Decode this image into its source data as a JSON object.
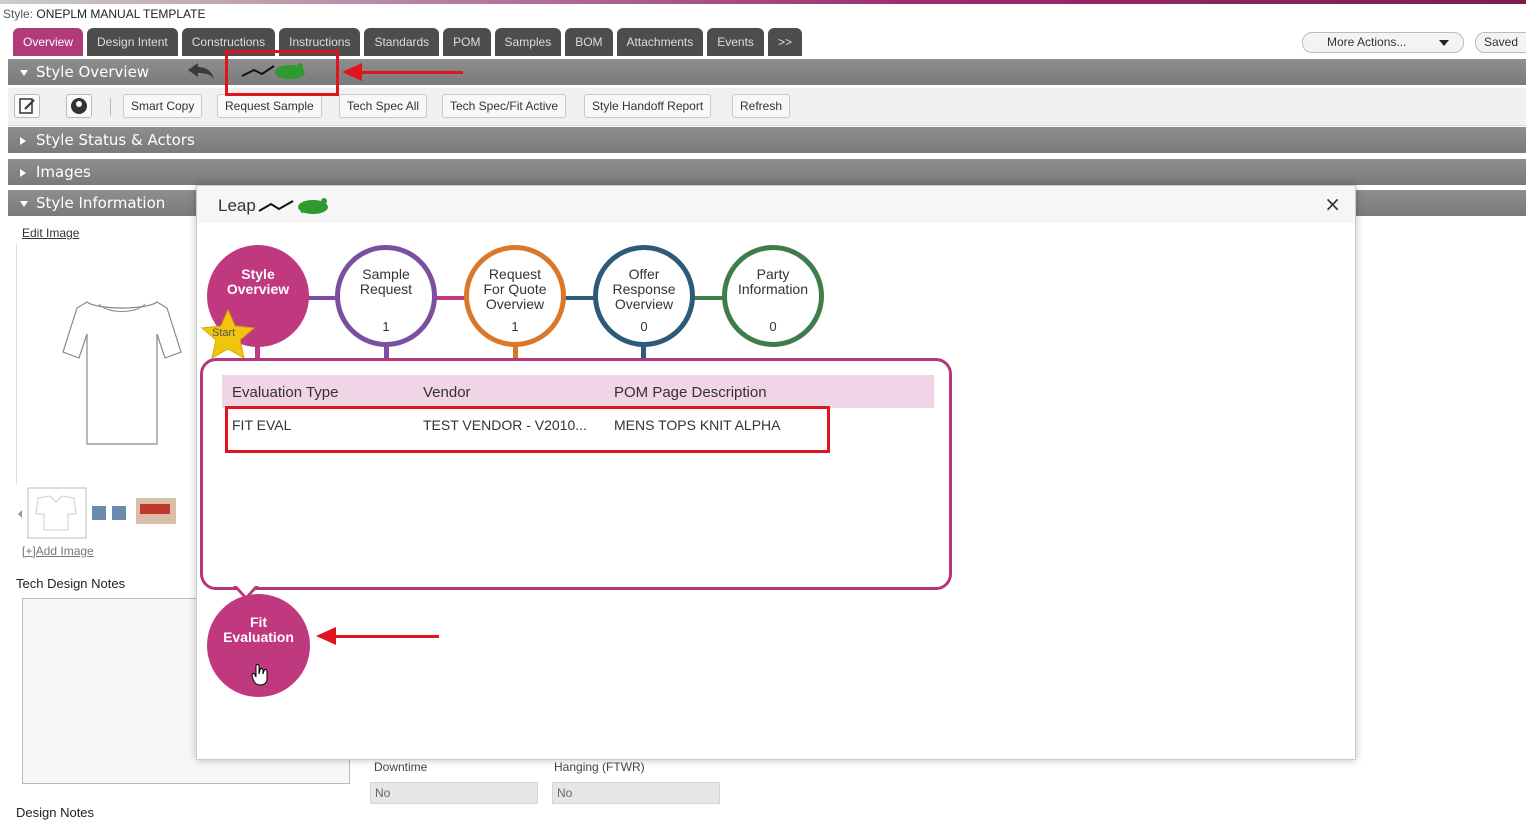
{
  "header": {
    "style_label": "Style:",
    "style_name": "ONEPLM MANUAL TEMPLATE"
  },
  "tabs": [
    {
      "label": "Overview",
      "active": true
    },
    {
      "label": "Design Intent"
    },
    {
      "label": "Constructions"
    },
    {
      "label": "Instructions"
    },
    {
      "label": "Standards"
    },
    {
      "label": "POM"
    },
    {
      "label": "Samples"
    },
    {
      "label": "BOM"
    },
    {
      "label": "Attachments"
    },
    {
      "label": "Events"
    },
    {
      "label": ">>"
    }
  ],
  "actions": {
    "more_actions": "More Actions...",
    "saved": "Saved"
  },
  "sections": {
    "style_overview": "Style Overview",
    "style_status": "Style Status & Actors",
    "images": "Images",
    "style_information": "Style Information"
  },
  "toolbar": {
    "buttons": [
      "Smart Copy",
      "Request Sample",
      "Tech Spec All",
      "Tech Spec/Fit Active",
      "Style Handoff Report",
      "Refresh"
    ]
  },
  "left": {
    "edit_image": "Edit Image",
    "add_image": "[+]Add Image",
    "tech_design_notes": "Tech Design Notes",
    "design_notes": "Design Notes",
    "fields": [
      {
        "label": "Downtime",
        "value": "No"
      },
      {
        "label": "Hanging (FTWR)",
        "value": "No"
      }
    ]
  },
  "modal": {
    "title": "Leap",
    "close": "×",
    "start_label": "Start",
    "nodes": [
      {
        "label_lines": [
          "Style",
          "Overview"
        ],
        "count": ""
      },
      {
        "label_lines": [
          "Sample",
          "Request"
        ],
        "count": "1"
      },
      {
        "label_lines": [
          "Request",
          "For Quote",
          "Overview"
        ],
        "count": "1"
      },
      {
        "label_lines": [
          "Offer",
          "Response",
          "Overview"
        ],
        "count": "0"
      },
      {
        "label_lines": [
          "Party",
          "Information"
        ],
        "count": "0"
      }
    ],
    "grid": {
      "columns": [
        "Evaluation Type",
        "Vendor",
        "POM Page Description"
      ],
      "rows": [
        [
          "FIT EVAL",
          "TEST VENDOR - V2010...",
          "MENS TOPS KNIT ALPHA"
        ]
      ]
    },
    "fit_node": {
      "label_lines": [
        "Fit",
        "Evaluation"
      ]
    }
  },
  "colors": {
    "accent": "#c0387e",
    "sample_ring": "#7b4fa0",
    "rfq_ring": "#d9782a",
    "offer_ring": "#2c5a78",
    "party_ring": "#3e7d4a",
    "annotation_red": "#e0141c"
  }
}
